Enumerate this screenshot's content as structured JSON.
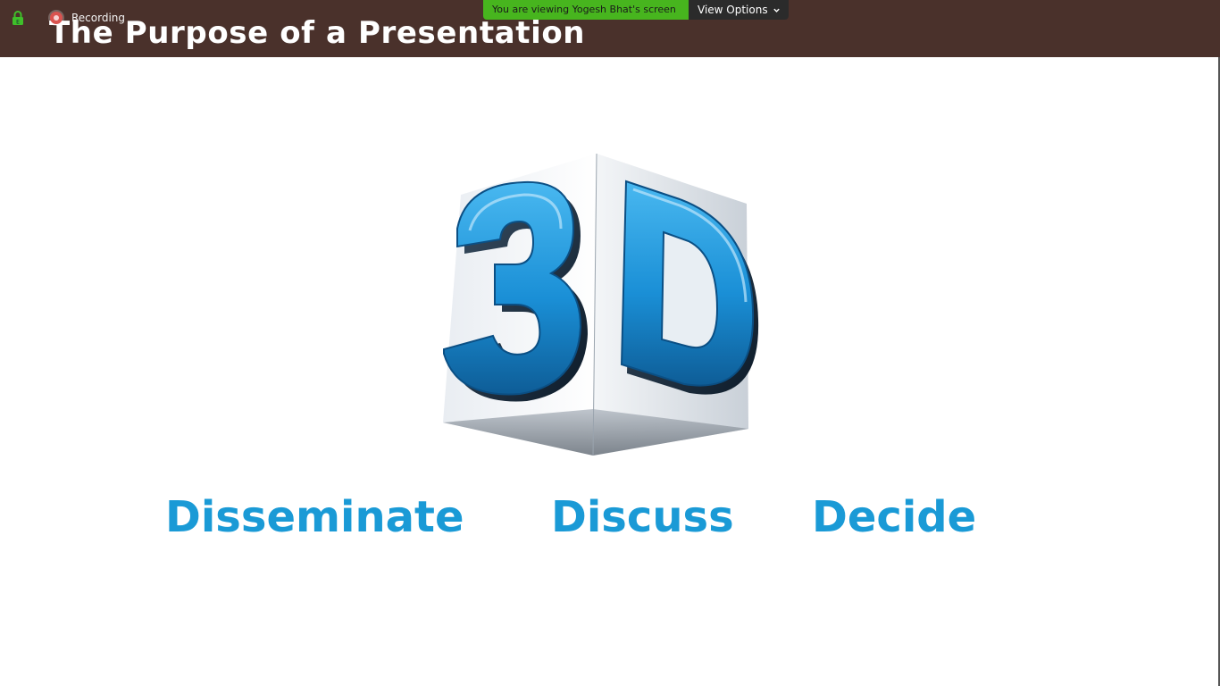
{
  "slide": {
    "title": "The Purpose of a Presentation",
    "logo_text": "3D",
    "words": [
      "Disseminate",
      "Discuss",
      "Decide"
    ],
    "accent_color": "#1a9ad6",
    "header_color": "#4a312b"
  },
  "meeting": {
    "recording_label": "Recording",
    "share_banner": "You are viewing Yogesh Bhat's screen",
    "view_options_label": "View Options",
    "icons": [
      "lock-icon",
      "recording-icon",
      "chevron-down-icon"
    ]
  }
}
